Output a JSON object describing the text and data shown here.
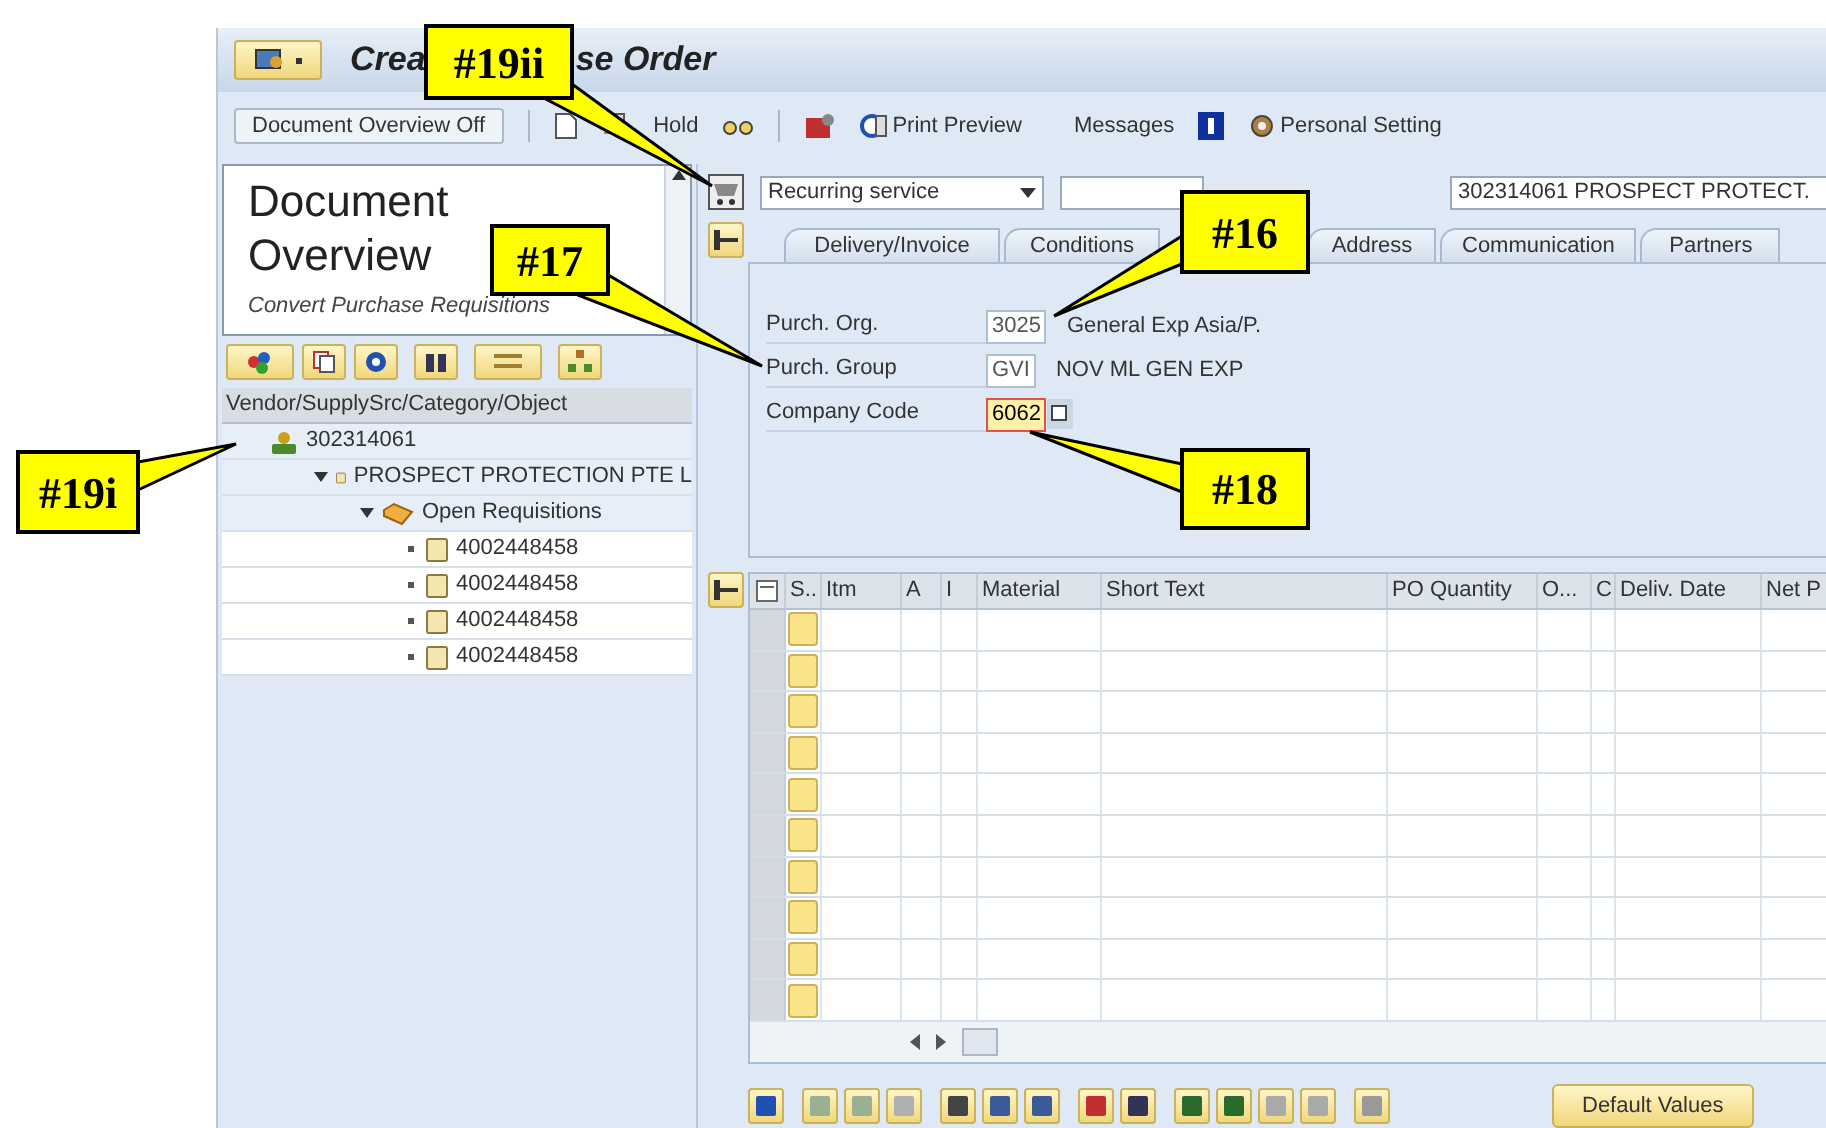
{
  "window": {
    "title_parts": [
      "Crea",
      "se Order"
    ]
  },
  "toolbar": {
    "overview_button": "Document Overview Off",
    "hold": "Hold",
    "print_preview": "Print Preview",
    "messages": "Messages",
    "personal_setting": "Personal Setting"
  },
  "document_overview": {
    "title": "Document Overview",
    "subtitle": "Convert Purchase Requisitions"
  },
  "tree": {
    "header": "Vendor/SupplySrc/Category/Object",
    "nodes": [
      {
        "label": "302314061",
        "kind": "vendor",
        "children": [
          {
            "label": "PROSPECT PROTECTION PTE L",
            "kind": "document",
            "expanded": true,
            "children": [
              {
                "label": "Open Requisitions",
                "kind": "folder",
                "expanded": true,
                "children": [
                  {
                    "label": "4002448458",
                    "kind": "document"
                  },
                  {
                    "label": "4002448458",
                    "kind": "document"
                  },
                  {
                    "label": "4002448458",
                    "kind": "document"
                  },
                  {
                    "label": "4002448458",
                    "kind": "document"
                  }
                ]
              }
            ]
          }
        ]
      }
    ]
  },
  "header": {
    "doc_type": "Recurring service",
    "vendor": "302314061 PROSPECT PROTECT."
  },
  "tabs": [
    {
      "label": "Delivery/Invoice",
      "selected": false
    },
    {
      "label": "Conditions",
      "selected": false
    },
    {
      "label": "Address",
      "selected": false
    },
    {
      "label": "Communication",
      "selected": false
    },
    {
      "label": "Partners",
      "selected": false
    }
  ],
  "org_fields": [
    {
      "label": "Purch. Org.",
      "value": "3025",
      "description": "General Exp Asia/P.",
      "focused": false,
      "kind": "plain"
    },
    {
      "label": "Purch. Group",
      "value": "GVI",
      "description": "NOV ML GEN EXP",
      "focused": false,
      "kind": "plain"
    },
    {
      "label": "Company Code",
      "value": "6062",
      "focused": true,
      "kind": "lookup"
    }
  ],
  "items_table": {
    "columns": [
      "S..",
      "Itm",
      "A",
      "I",
      "Material",
      "Short Text",
      "PO Quantity",
      "O...",
      "C",
      "Deliv. Date",
      "Net P"
    ],
    "rows": [
      {
        "kind": "empty"
      },
      {
        "kind": "empty"
      },
      {
        "kind": "empty"
      },
      {
        "kind": "empty"
      },
      {
        "kind": "empty"
      },
      {
        "kind": "empty"
      },
      {
        "kind": "empty"
      },
      {
        "kind": "empty"
      },
      {
        "kind": "empty"
      },
      {
        "kind": "empty"
      }
    ]
  },
  "default_values_button": "Default Values",
  "callouts": [
    {
      "label": "#19ii"
    },
    {
      "label": "#17"
    },
    {
      "label": "#16"
    },
    {
      "label": "#18"
    },
    {
      "label": "#19i"
    }
  ]
}
